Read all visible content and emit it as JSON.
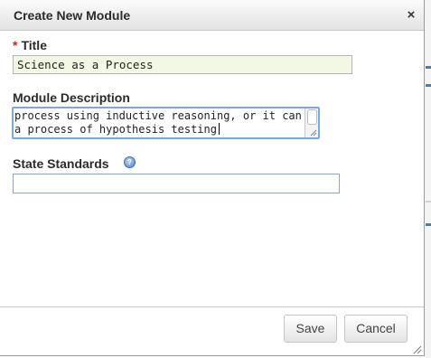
{
  "dialog": {
    "title": "Create New Module",
    "close_glyph": "×"
  },
  "fields": {
    "title": {
      "required_marker": "*",
      "label": "Title",
      "value": "Science as a Process"
    },
    "description": {
      "label": "Module Description",
      "line1": "process using inductive reasoning, or it can be",
      "line2": "a process of hypothesis testing"
    },
    "standards": {
      "label": "State Standards",
      "help_glyph": "?",
      "value": ""
    }
  },
  "buttons": {
    "save": "Save",
    "cancel": "Cancel"
  },
  "icons": {
    "close": "close-icon",
    "help": "help-icon",
    "resize": "resize-grip-icon"
  },
  "colors": {
    "required": "#d0261c",
    "focus_border": "#7aa7e0",
    "title_input_bg": "#f2f8e4",
    "help_icon": "#4e84c9"
  }
}
